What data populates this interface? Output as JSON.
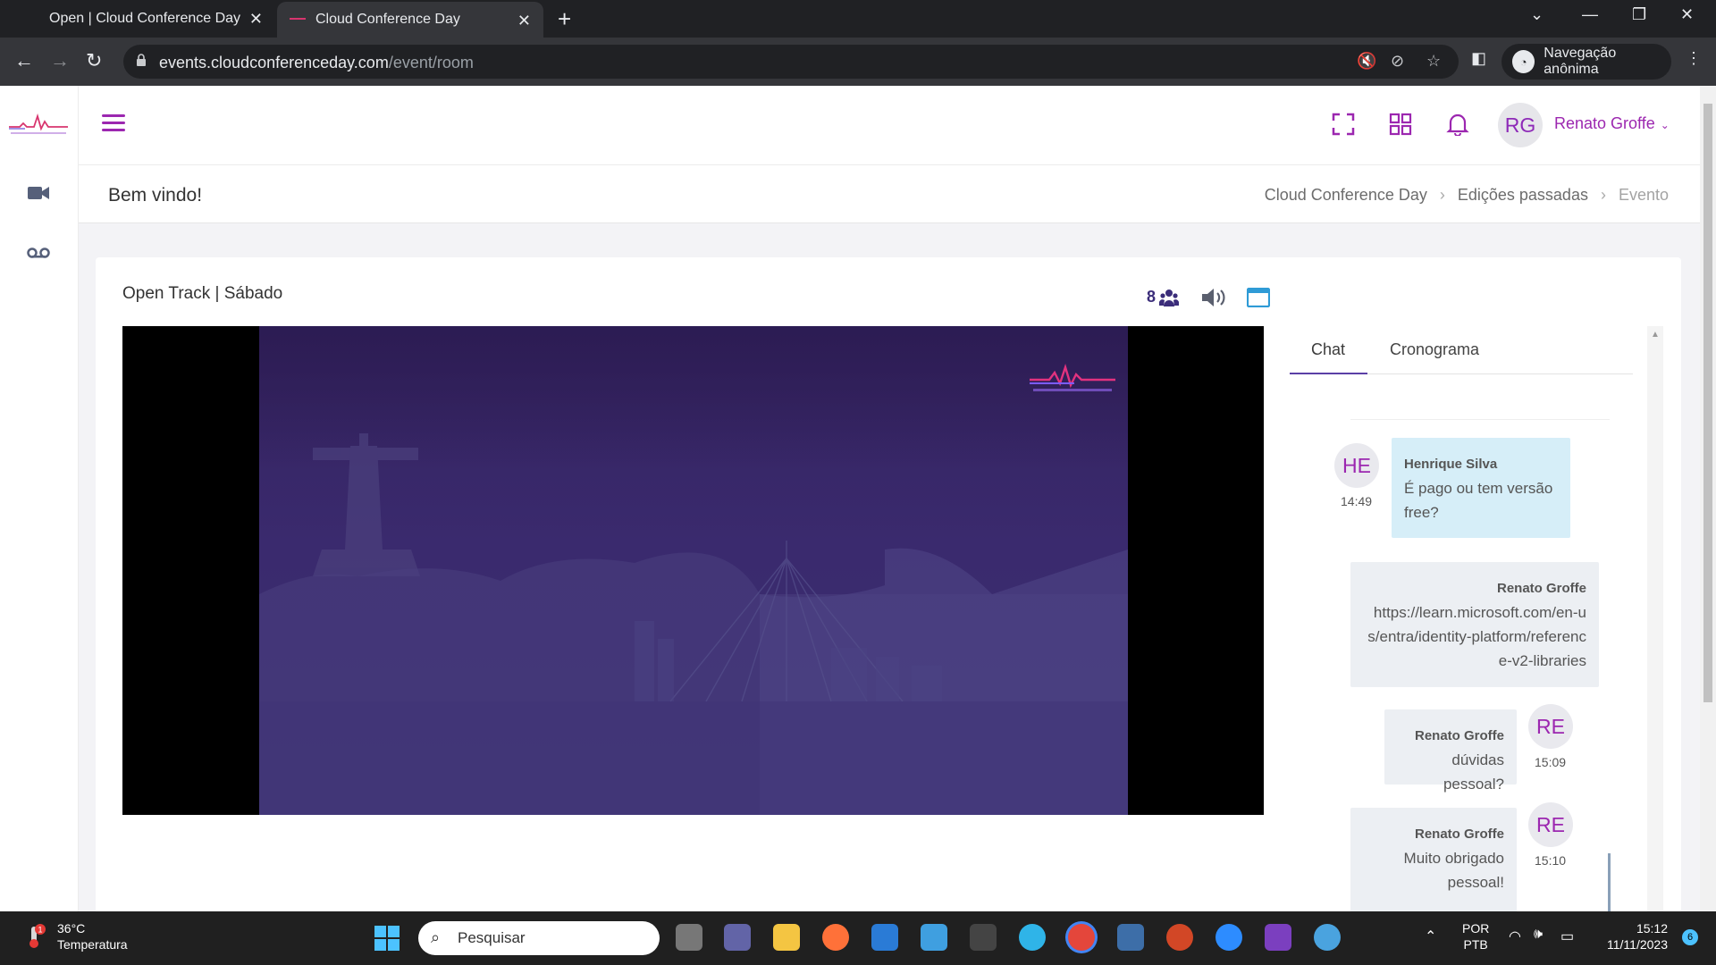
{
  "browser": {
    "tabs": [
      {
        "title": "Open | Cloud Conference Day",
        "active": false
      },
      {
        "title": "Cloud Conference Day",
        "active": true
      }
    ],
    "url_host": "events.cloudconferenceday.com",
    "url_path": "/event/room",
    "incognito_label": "Navegação anônima"
  },
  "header": {
    "user_initials": "RG",
    "user_name": "Renato Groffe"
  },
  "subheader": {
    "welcome": "Bem vindo!",
    "breadcrumb": [
      "Cloud Conference Day",
      "Edições passadas",
      "Evento"
    ]
  },
  "room": {
    "title": "Open Track | Sábado",
    "viewer_count": "8"
  },
  "chat": {
    "tabs": [
      "Chat",
      "Cronograma"
    ],
    "active_tab": "Chat",
    "messages": [
      {
        "initials": "HE",
        "author": "Henrique Silva",
        "time": "14:49",
        "text": "É pago ou tem versão free?",
        "side": "left"
      },
      {
        "initials": "",
        "author": "Renato Groffe",
        "time": "",
        "text": "https://learn.microsoft.com/en-us/entra/identity-platform/reference-v2-libraries",
        "side": "right"
      },
      {
        "initials": "RE",
        "author": "Renato Groffe",
        "time": "15:09",
        "text": "dúvidas pessoal?",
        "side": "right"
      },
      {
        "initials": "RE",
        "author": "Renato Groffe",
        "time": "15:10",
        "text": "Muito obrigado pessoal!",
        "side": "right"
      }
    ]
  },
  "taskbar": {
    "weather_temp": "36°C",
    "weather_label": "Temperatura",
    "weather_badge": "1",
    "search_placeholder": "Pesquisar",
    "lang_1": "POR",
    "lang_2": "PTB",
    "time": "15:12",
    "date": "11/11/2023",
    "notifications": "6"
  },
  "colors": {
    "accent": "#9c27b0",
    "tab_underline": "#5b3fa6",
    "video_bg": "#3a2a6e",
    "bubble_left": "#d6eef8",
    "bubble_right": "#eceff3"
  }
}
